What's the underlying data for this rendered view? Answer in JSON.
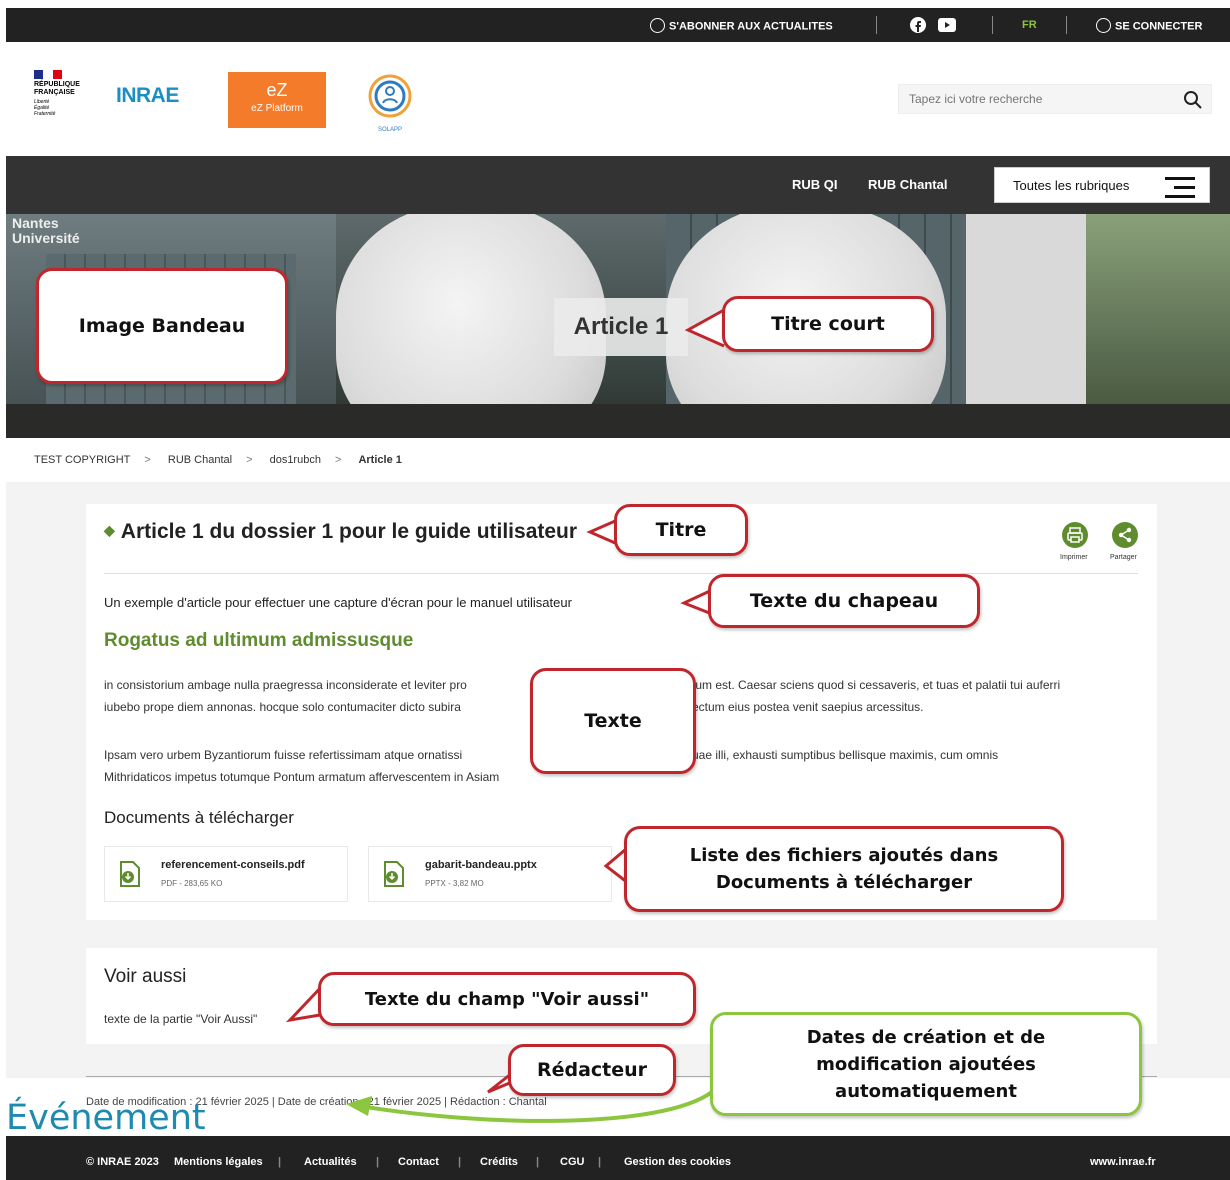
{
  "topbar": {
    "subscribe": "S'ABONNER AUX ACTUALITES",
    "lang": "FR",
    "login": "SE CONNECTER",
    "accent": "#5e8c2e"
  },
  "header": {
    "rf_lines": [
      "RÉPUBLIQUE",
      "FRANÇAISE"
    ],
    "rf_motto": [
      "Liberté",
      "Égalité",
      "Fraternité"
    ],
    "inrae": "INRAE",
    "ez_big": "eZ",
    "ez_small": "eZ Platform",
    "solapp": "SOLAPP",
    "search_placeholder": "Tapez ici votre recherche"
  },
  "nav": {
    "items": [
      "RUB QI",
      "RUB Chantal"
    ],
    "all_rubriques": "Toutes les rubriques"
  },
  "banner": {
    "watermark": [
      "Nantes",
      "Université"
    ],
    "title": "Article 1"
  },
  "breadcrumb": [
    "TEST COPYRIGHT",
    "RUB Chantal",
    "dos1rubch",
    "Article 1"
  ],
  "article": {
    "title": "Article 1 du dossier 1 pour le guide utilisateur",
    "print": "Imprimer",
    "share": "Partager",
    "chapeau": "Un exemple d'article pour effectuer une capture d'écran pour le manuel utilisateur",
    "heading": "Rogatus ad ultimum admissusque",
    "para1_a": "in consistorium ambage nulla praegressa inconsiderate et leviter pro",
    "para1_b": "tum est. Caesar sciens quod si cessaveris, et tuas et palatii tui auferri",
    "para1_c": "iubebo prope diem annonas. hocque solo contumaciter dicto subira",
    "para1_d": "ectum eius postea venit saepius arcessitus.",
    "para2_a": "Ipsam vero urbem Byzantiorum fuisse refertissimam atque ornatissi",
    "para2_b": "uae illi, exhausti sumptibus bellisque maximis, cum omnis",
    "para2_c": "Mithridaticos impetus totumque Pontum armatum affervescentem in Asiam",
    "docs_heading": "Documents à télécharger",
    "files": [
      {
        "name": "referencement-conseils.pdf",
        "meta": "PDF - 283,65 KO"
      },
      {
        "name": "gabarit-bandeau.pptx",
        "meta": "PPTX - 3,82 MO"
      }
    ]
  },
  "voir_aussi": {
    "heading": "Voir aussi",
    "text": "texte de la partie \"Voir Aussi\""
  },
  "dates": "Date de modification : 21 février 2025 | Date de création : 21 février 2025 | Rédaction : Chantal",
  "evenement": "Événement",
  "callouts": {
    "image_bandeau": "Image Bandeau",
    "titre_court": "Titre court",
    "titre": "Titre",
    "chapeau": "Texte du chapeau",
    "texte": "Texte",
    "liste": "Liste des fichiers ajoutés dans Documents à télécharger",
    "voir_aussi": "Texte du champ \"Voir aussi\"",
    "redacteur": "Rédacteur",
    "dates": "Dates de création et de modification ajoutées automatiquement"
  },
  "footer": {
    "items": [
      "© INRAE 2023",
      "Mentions légales",
      "Actualités",
      "Contact",
      "Crédits",
      "CGU",
      "Gestion des cookies"
    ],
    "site": "www.inrae.fr"
  }
}
